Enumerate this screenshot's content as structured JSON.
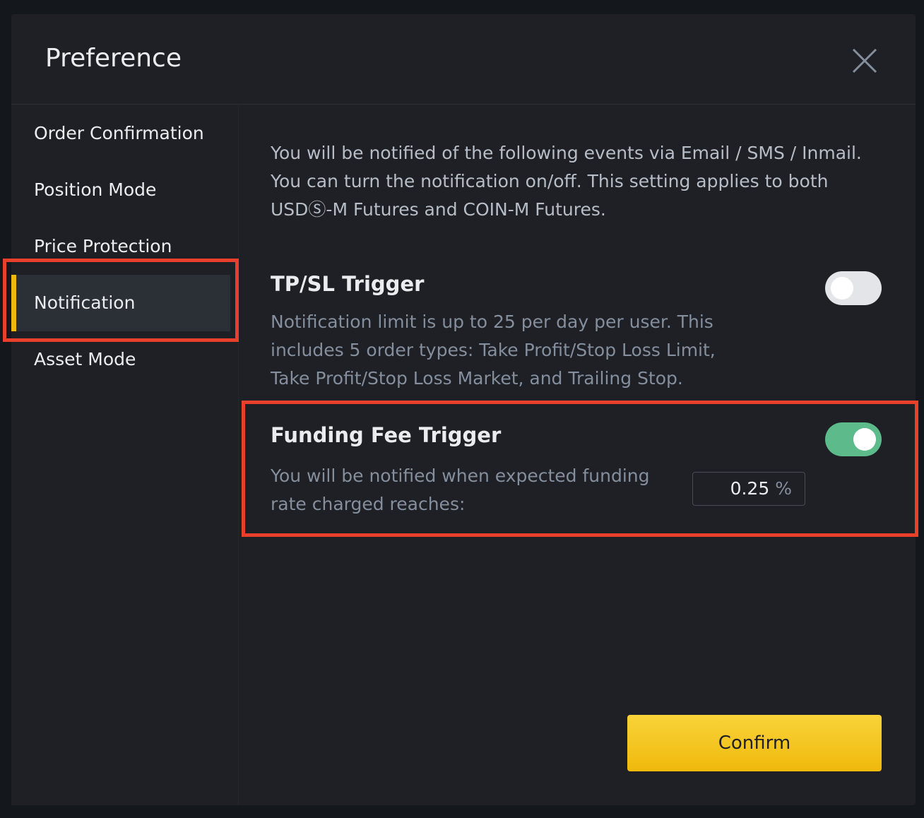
{
  "modal": {
    "title": "Preference",
    "close_icon": "close-icon"
  },
  "sidebar": {
    "items": [
      {
        "label": "Order Confirmation"
      },
      {
        "label": "Position Mode"
      },
      {
        "label": "Price Protection"
      },
      {
        "label": "Notification",
        "active": true
      },
      {
        "label": "Asset Mode"
      }
    ]
  },
  "content": {
    "intro": "You will be notified of the following events via Email / SMS / Inmail. You can turn the notification on/off. This setting applies to both USDⓈ-M Futures and COIN-M Futures.",
    "tpsl": {
      "title": "TP/SL Trigger",
      "description": "Notification limit is up to 25 per day per user. This includes 5 order types: Take Profit/Stop Loss Limit, Take Profit/Stop Loss Market, and Trailing Stop.",
      "enabled": false
    },
    "funding": {
      "title": "Funding Fee Trigger",
      "description": "You will be notified when expected funding rate charged reaches:",
      "enabled": true,
      "rate_value": "0.25",
      "rate_unit": "%"
    }
  },
  "confirm_label": "Confirm",
  "colors": {
    "accent": "#f0b90b",
    "toggle_on": "#5dba8a",
    "toggle_off": "#e3e5e8",
    "annotation": "#e8402a"
  }
}
